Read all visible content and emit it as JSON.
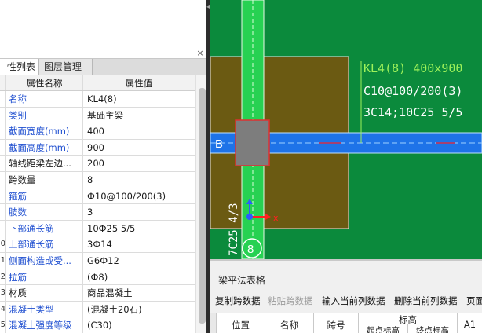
{
  "panel": {
    "close_glyph": "×",
    "tabs": [
      {
        "label": "属性列表",
        "visible_label": "性列表"
      },
      {
        "label": "图层管理"
      }
    ],
    "columns": {
      "name": "属性名称",
      "value": "属性值"
    },
    "rows": [
      {
        "num": "",
        "name": "名称",
        "value": "KL4(8)",
        "blue": true
      },
      {
        "num": "",
        "name": "类别",
        "value": "基础主梁",
        "blue": true
      },
      {
        "num": "",
        "name": "截面宽度(mm)",
        "value": "400",
        "blue": true
      },
      {
        "num": "",
        "name": "截面高度(mm)",
        "value": "900",
        "blue": true
      },
      {
        "num": "",
        "name": "轴线距梁左边...",
        "value": "200",
        "blue": false
      },
      {
        "num": "",
        "name": "跨数量",
        "value": "8",
        "blue": false
      },
      {
        "num": "",
        "name": "箍筋",
        "value": "Ф10@100/200(3)",
        "blue": true
      },
      {
        "num": "",
        "name": "肢数",
        "value": "3",
        "blue": true
      },
      {
        "num": "",
        "name": "下部通长筋",
        "value": "10Ф25 5/5",
        "blue": true
      },
      {
        "num": "0",
        "name": "上部通长筋",
        "value": "3Ф14",
        "blue": true
      },
      {
        "num": "1",
        "name": "侧面构造或受...",
        "value": "G6Ф12",
        "blue": true
      },
      {
        "num": "2",
        "name": "拉筋",
        "value": "(Ф8)",
        "blue": true
      },
      {
        "num": "3",
        "name": "材质",
        "value": "商品混凝土",
        "blue": false
      },
      {
        "num": "4",
        "name": "混凝土类型",
        "value": "(混凝土20石)",
        "blue": true
      },
      {
        "num": "5",
        "name": "混凝土强度等级",
        "value": "(C30)",
        "blue": true
      }
    ]
  },
  "canvas": {
    "axis_label": "B",
    "axis_number": "8",
    "beam_annotation": [
      "KL4(8) 400x900",
      "C10@100/200(3)",
      "3C14;10C25 5/5"
    ],
    "vertical_annotation": "7C25 4/3",
    "colors": {
      "background": "#0b8a3c",
      "foundation": "#6b5a12",
      "beam": "#1e73e8",
      "column": "#7d7d7d",
      "column_border": "#e03030",
      "vertical_beam": "#27d152",
      "annotation": "#9ef25a"
    },
    "icons": [
      "origin-icon"
    ]
  },
  "bottom_panel": {
    "title": "梁平法表格",
    "toolbar": [
      {
        "label": "复制跨数据",
        "enabled": true
      },
      {
        "label": "粘贴跨数据",
        "enabled": false
      },
      {
        "label": "输入当前列数据",
        "enabled": true
      },
      {
        "label": "删除当前列数据",
        "enabled": true
      },
      {
        "label": "页面",
        "enabled": true
      }
    ],
    "columns": {
      "position": "位置",
      "name": "名称",
      "span": "跨号",
      "elevation": "标高",
      "start_elevation": "起点标高",
      "end_elevation": "终点标高",
      "a1": "A1"
    }
  }
}
